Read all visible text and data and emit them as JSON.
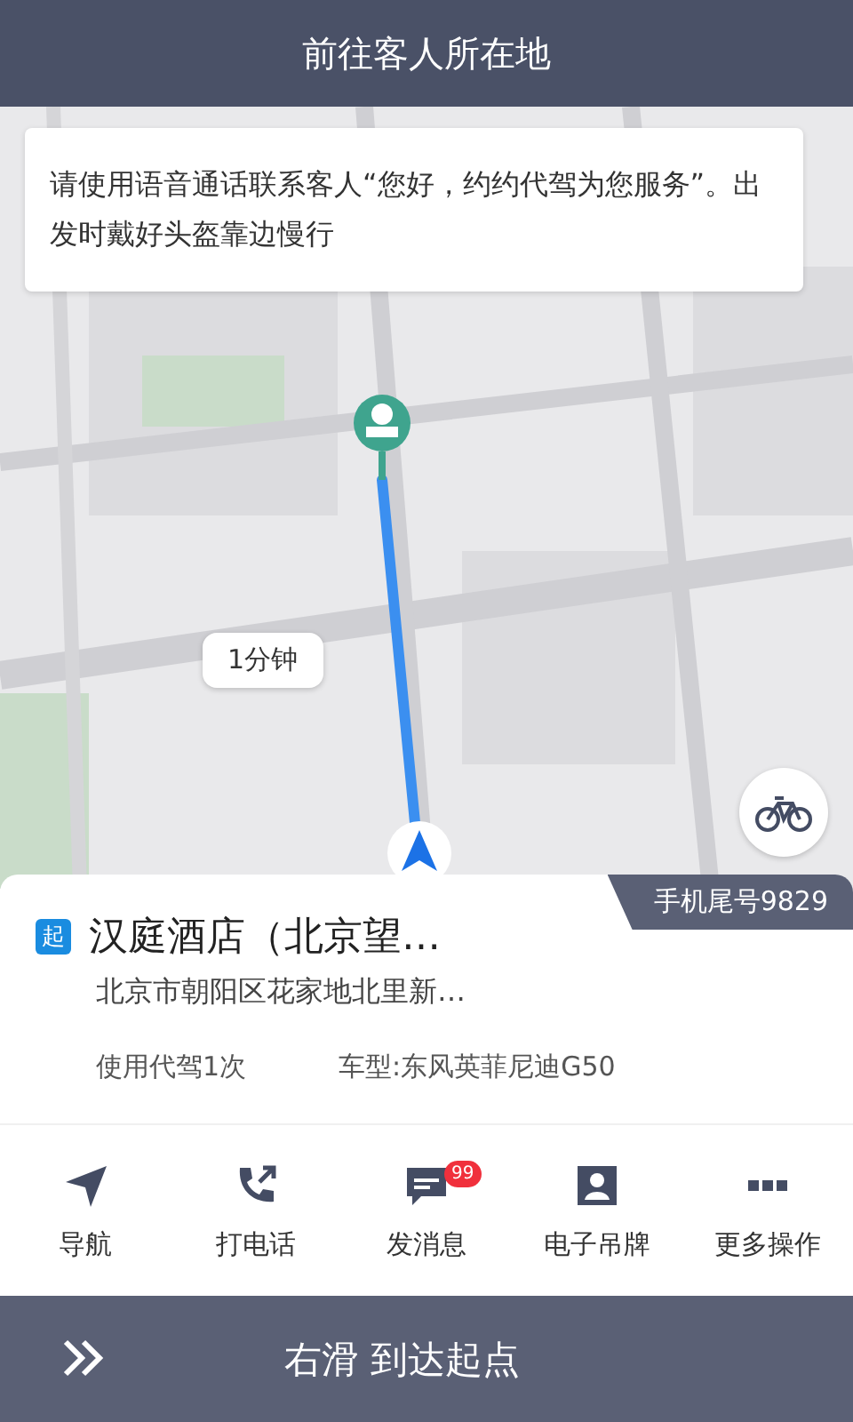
{
  "header": {
    "title": "前往客人所在地"
  },
  "tip": {
    "text": "请使用语音通话联系客人“您好，约约代驾为您服务”。出发时戴好头盔靠边慢行"
  },
  "map": {
    "eta_bubble": "1分钟"
  },
  "order": {
    "phone_badge": "手机尾号9829",
    "start_tag": "起",
    "place_name": "汉庭酒店（北京望…",
    "address": "北京市朝阳区花家地北里新…",
    "usage": "使用代驾1次",
    "car_model": "车型:东风英菲尼迪G50"
  },
  "actions": [
    {
      "kind": "navigate",
      "label": "导航"
    },
    {
      "kind": "call",
      "label": "打电话"
    },
    {
      "kind": "message",
      "label": "发消息",
      "badge": "99"
    },
    {
      "kind": "tag",
      "label": "电子吊牌"
    },
    {
      "kind": "more",
      "label": "更多操作"
    }
  ],
  "slider": {
    "text": "右滑 到达起点"
  }
}
